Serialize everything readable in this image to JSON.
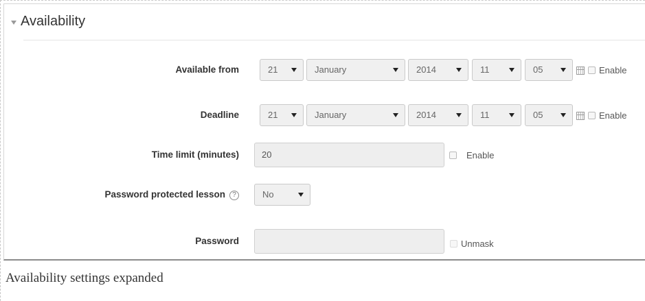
{
  "section": {
    "title": "Availability"
  },
  "available_from": {
    "label": "Available from",
    "day": "21",
    "month": "January",
    "year": "2014",
    "hour": "11",
    "minute": "05",
    "enable_label": "Enable"
  },
  "deadline": {
    "label": "Deadline",
    "day": "21",
    "month": "January",
    "year": "2014",
    "hour": "11",
    "minute": "05",
    "enable_label": "Enable"
  },
  "time_limit": {
    "label": "Time limit (minutes)",
    "value": "20",
    "enable_label": "Enable"
  },
  "password_protected": {
    "label": "Password protected lesson",
    "value": "No",
    "help_icon": "?"
  },
  "password": {
    "label": "Password",
    "value": "",
    "unmask_label": "Unmask"
  },
  "caption": "Availability settings expanded"
}
